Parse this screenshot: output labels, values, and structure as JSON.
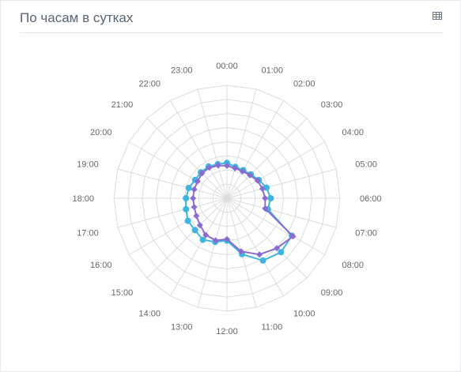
{
  "header": {
    "title": "По часам в сутках",
    "table_icon": "table-icon"
  },
  "colors": {
    "series_a": "#3eb5de",
    "series_b": "#8b6bd0",
    "grid": "#dcdcdc",
    "label": "#666666"
  },
  "chart_data": {
    "type": "radar",
    "categories": [
      "00:00",
      "01:00",
      "02:00",
      "03:00",
      "04:00",
      "05:00",
      "06:00",
      "07:00",
      "08:00",
      "09:00",
      "10:00",
      "11:00",
      "12:00",
      "13:00",
      "14:00",
      "15:00",
      "16:00",
      "17:00",
      "18:00",
      "19:00",
      "20:00",
      "21:00",
      "22:00",
      "23:00"
    ],
    "rmax": 8,
    "grid_rings": 8,
    "series": [
      {
        "values": [
          2.5,
          2.3,
          2.3,
          2.4,
          2.6,
          2.9,
          3.1,
          3.0,
          5.3,
          5.4,
          5.1,
          4.1,
          3.0,
          3.2,
          3.4,
          3.2,
          3.2,
          3.0,
          2.9,
          2.8,
          2.6,
          2.6,
          2.6,
          2.5
        ],
        "marker": "circle"
      },
      {
        "values": [
          2.3,
          2.2,
          2.2,
          2.3,
          2.5,
          2.6,
          2.7,
          2.8,
          5.4,
          5.0,
          4.6,
          3.9,
          2.9,
          3.1,
          3.0,
          2.7,
          2.5,
          2.4,
          2.4,
          2.4,
          2.4,
          2.5,
          2.5,
          2.4
        ],
        "marker": "diamond"
      }
    ]
  }
}
